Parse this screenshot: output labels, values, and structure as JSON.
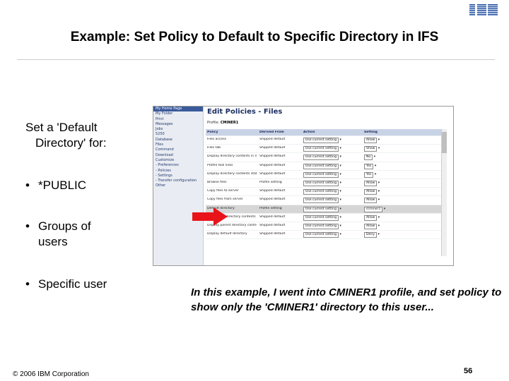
{
  "title": "Example:  Set Policy to Default to Specific Directory in IFS",
  "lead": {
    "line1": "Set a 'Default",
    "line2": "Directory' for:"
  },
  "bullets": [
    {
      "line1": "*PUBLIC",
      "line2": ""
    },
    {
      "line1": "Groups of",
      "line2": "users"
    },
    {
      "line1": "Specific user",
      "line2": ""
    }
  ],
  "caption": "In this example, I went into CMINER1 profile, and set policy to show only the 'CMINER1' directory to this user...",
  "footer": "© 2006 IBM Corporation",
  "page_number": "56",
  "screenshot": {
    "sidebar": [
      "My Home Page",
      "My Folder",
      "Print",
      "Messages",
      "Jobs",
      "5250",
      "Database",
      "Files",
      "Command",
      "Download",
      "Customize",
      "- Preferences",
      "- Policies",
      "- Settings",
      "- Transfer configuration",
      "Other"
    ],
    "heading": "Edit Policies - Files",
    "profile_label": "Profile:",
    "profile_value": "CMINER1",
    "columns": [
      "Policy",
      "Derived From",
      "Action",
      "Setting"
    ],
    "rows": [
      {
        "policy": "Files access",
        "derived": "Shipped default",
        "action": "Use current setting",
        "setting": "Allow"
      },
      {
        "policy": "Files tab",
        "derived": "Shipped default",
        "action": "Use current setting",
        "setting": "Show"
      },
      {
        "policy": "Display directory contents in new window",
        "derived": "Shipped default",
        "action": "Use current setting",
        "setting": "No"
      },
      {
        "policy": "Profile tool links",
        "derived": "Shipped default",
        "action": "Use current setting",
        "setting": "Yes"
      },
      {
        "policy": "Display directory contents statistics",
        "derived": "Shipped default",
        "action": "Use current setting",
        "setting": "Yes"
      },
      {
        "policy": "Browse files",
        "derived": "Profile setting",
        "action": "Use current setting",
        "setting": "Allow"
      },
      {
        "policy": "Copy files to server",
        "derived": "Shipped default",
        "action": "Use current setting",
        "setting": "Allow"
      },
      {
        "policy": "Copy files from server",
        "derived": "Shipped default",
        "action": "Use current setting",
        "setting": "Allow"
      },
      {
        "policy": "Default directory",
        "derived": "Profile setting",
        "action": "Use current setting",
        "setting": "/cminer1"
      },
      {
        "policy": "Display subdirectory contents",
        "derived": "Shipped default",
        "action": "Use current setting",
        "setting": "Allow"
      },
      {
        "policy": "Display parent directory contents",
        "derived": "Shipped default",
        "action": "Use current setting",
        "setting": "Allow"
      },
      {
        "policy": "Display default directory",
        "derived": "Shipped default",
        "action": "Use current setting",
        "setting": "Deny"
      }
    ],
    "selected_row": 8
  },
  "colors": {
    "accent_arrow": "#e8141a",
    "header_bg": "#c9d3e6",
    "ibm_blue": "#1f4da0"
  }
}
